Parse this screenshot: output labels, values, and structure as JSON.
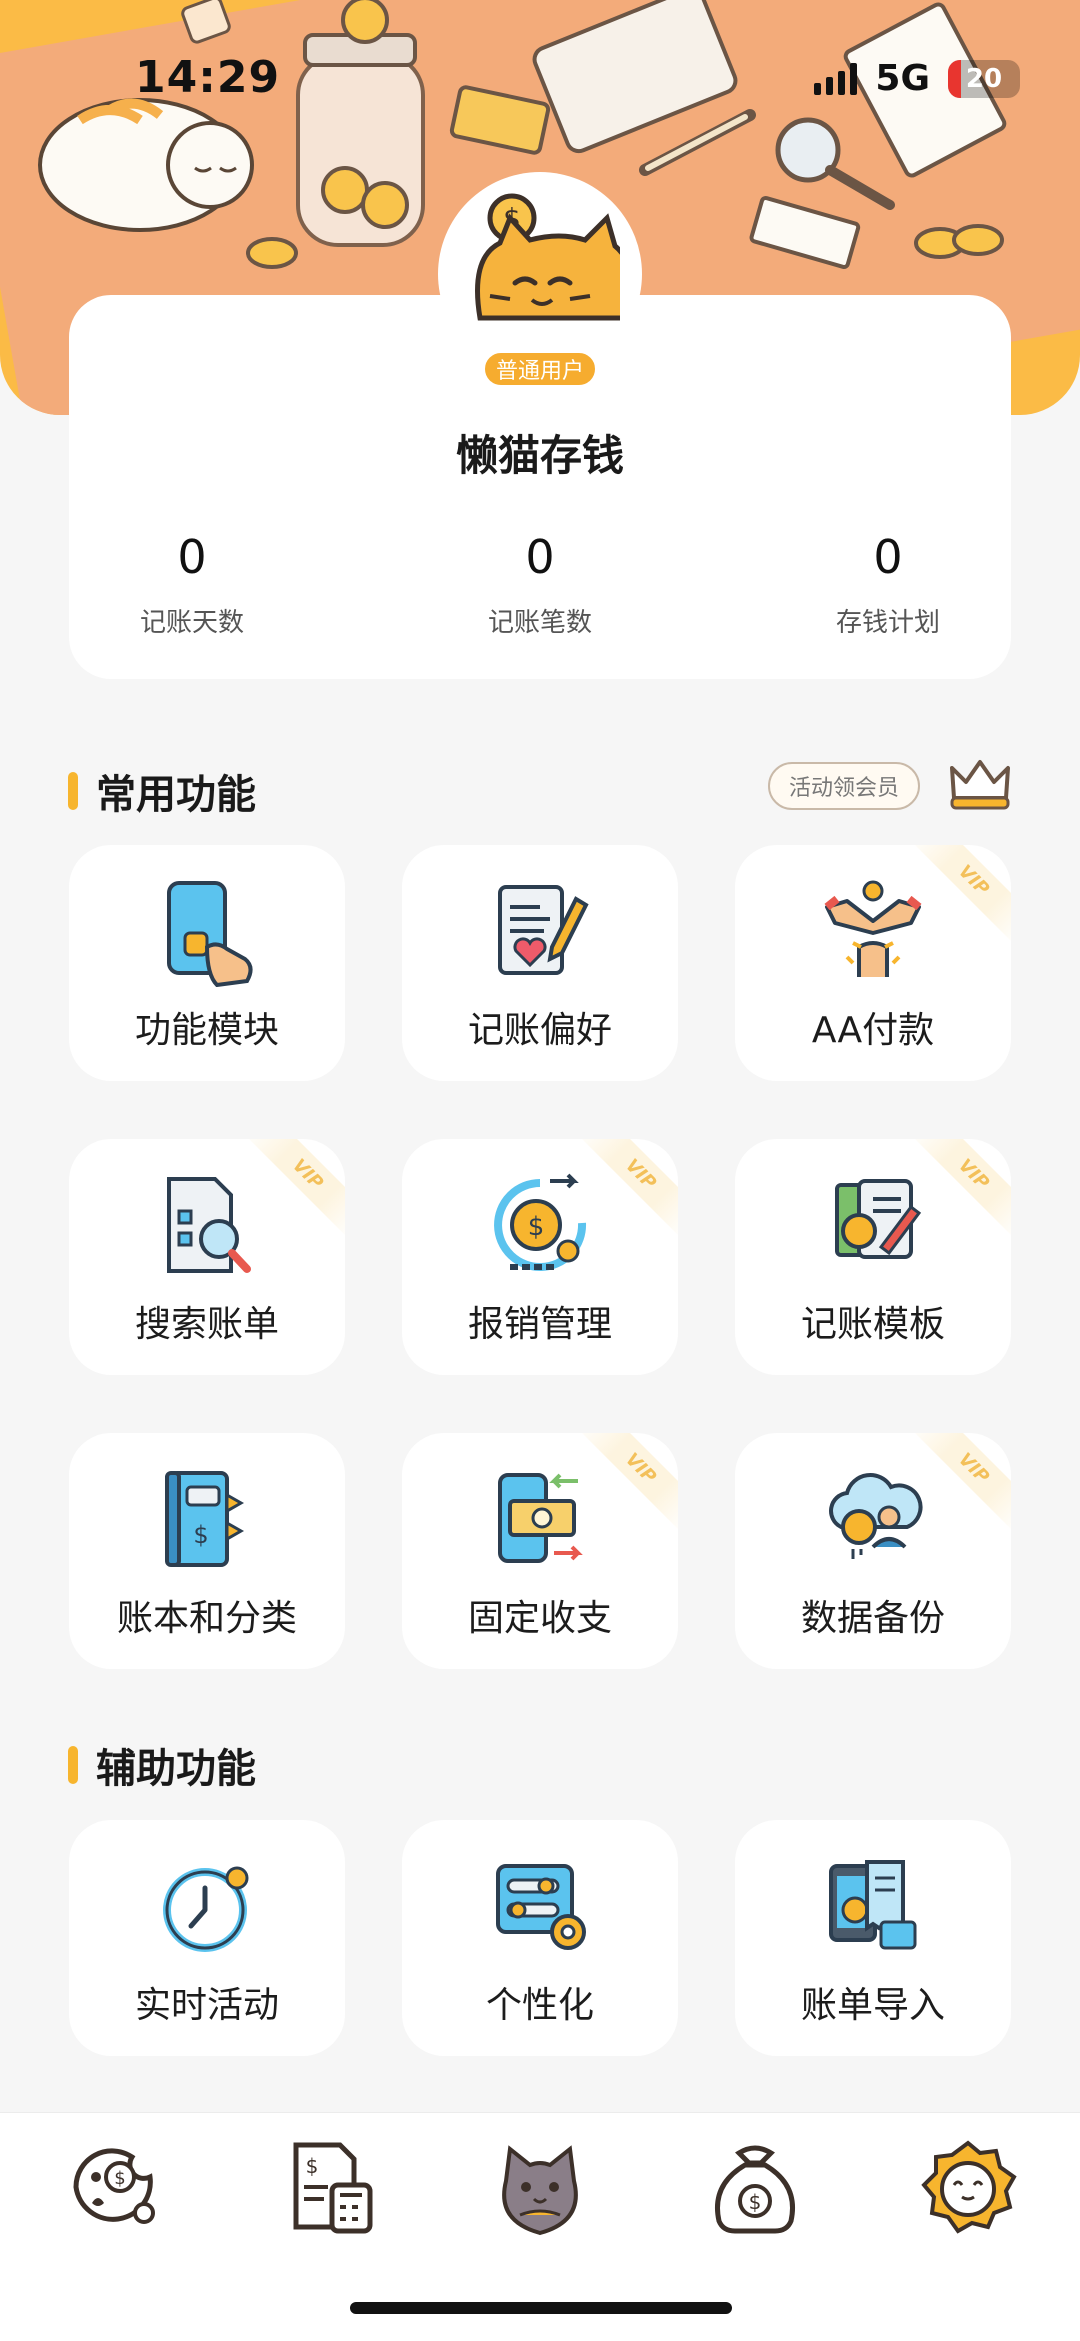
{
  "status_bar": {
    "time": "14:29",
    "network": "5G",
    "battery": "20"
  },
  "profile": {
    "badge": "普通用户",
    "name": "懒猫存钱",
    "stats": [
      {
        "value": "0",
        "label": "记账天数"
      },
      {
        "value": "0",
        "label": "记账笔数"
      },
      {
        "value": "0",
        "label": "存钱计划"
      }
    ]
  },
  "common": {
    "title": "常用功能",
    "promo": "活动领会员",
    "vip_tag": "VIP",
    "items": [
      {
        "label": "功能模块",
        "icon": "phone-touch-icon",
        "vip": false
      },
      {
        "label": "记账偏好",
        "icon": "heart-note-icon",
        "vip": false
      },
      {
        "label": "AA付款",
        "icon": "handshake-coin-icon",
        "vip": true
      },
      {
        "label": "搜索账单",
        "icon": "search-document-icon",
        "vip": true
      },
      {
        "label": "报销管理",
        "icon": "refund-coin-icon",
        "vip": true
      },
      {
        "label": "记账模板",
        "icon": "template-coin-icon",
        "vip": true
      },
      {
        "label": "账本和分类",
        "icon": "ledger-book-icon",
        "vip": false
      },
      {
        "label": "固定收支",
        "icon": "bill-transfer-icon",
        "vip": true
      },
      {
        "label": "数据备份",
        "icon": "cloud-backup-icon",
        "vip": true
      }
    ]
  },
  "aux": {
    "title": "辅助功能",
    "items": [
      {
        "label": "实时活动",
        "icon": "clock-icon"
      },
      {
        "label": "个性化",
        "icon": "settings-toggle-icon"
      },
      {
        "label": "账单导入",
        "icon": "bill-import-icon"
      }
    ]
  },
  "tabbar": [
    "cookie-coin-tab-icon",
    "bill-calculator-tab-icon",
    "cat-tab-icon",
    "money-bag-tab-icon",
    "cat-badge-tab-icon"
  ],
  "colors": {
    "accent": "#f7b52e",
    "header": "#fbbb46",
    "desk": "#f3ab7a",
    "background": "#f6f6f6"
  }
}
